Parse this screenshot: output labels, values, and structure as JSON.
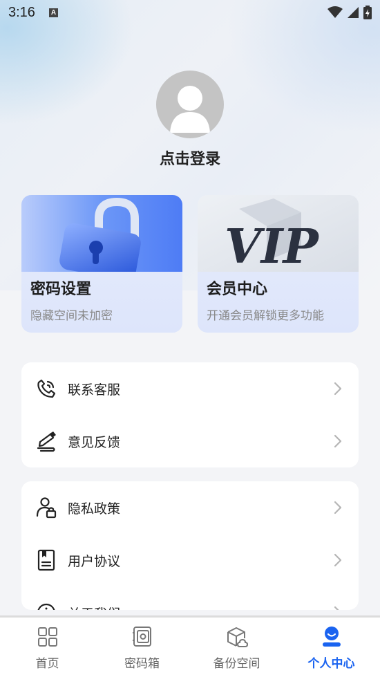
{
  "status_bar": {
    "time": "3:16"
  },
  "profile": {
    "login_text": "点击登录"
  },
  "cards": {
    "password": {
      "title": "密码设置",
      "subtitle": "隐藏空间未加密"
    },
    "vip": {
      "title": "会员中心",
      "subtitle": "开通会员解锁更多功能",
      "badge": "VIP"
    }
  },
  "menu_group_1": [
    {
      "label": "联系客服",
      "icon": "phone-support-icon"
    },
    {
      "label": "意见反馈",
      "icon": "feedback-pen-icon"
    }
  ],
  "menu_group_2": [
    {
      "label": "隐私政策",
      "icon": "privacy-user-lock-icon"
    },
    {
      "label": "用户协议",
      "icon": "agreement-document-icon"
    },
    {
      "label": "关于我们",
      "icon": "info-icon"
    }
  ],
  "tabbar": {
    "tabs": [
      {
        "label": "首页",
        "icon": "grid-home-icon"
      },
      {
        "label": "密码箱",
        "icon": "safe-box-icon"
      },
      {
        "label": "备份空间",
        "icon": "backup-box-icon"
      },
      {
        "label": "个人中心",
        "icon": "person-icon"
      }
    ],
    "active_index": 3,
    "active_color": "#1a63f0"
  }
}
